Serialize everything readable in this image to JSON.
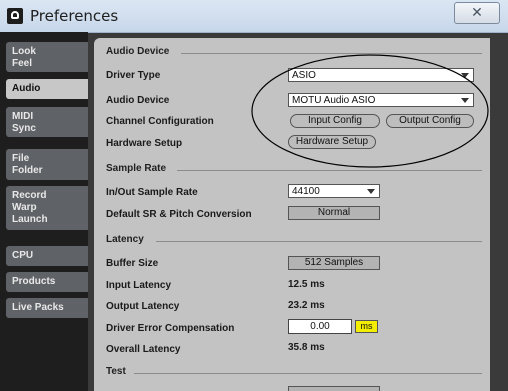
{
  "window": {
    "title": "Preferences",
    "close_glyph": "✕"
  },
  "sidebar": {
    "tabs": [
      {
        "lines": [
          "Look",
          "Feel"
        ]
      },
      {
        "lines": [
          "Audio"
        ]
      },
      {
        "lines": [
          "MIDI",
          "Sync"
        ]
      },
      {
        "lines": [
          "File",
          "Folder"
        ]
      },
      {
        "lines": [
          "Record",
          "Warp",
          "Launch"
        ]
      },
      {
        "lines": [
          "CPU"
        ]
      },
      {
        "lines": [
          "Products"
        ]
      },
      {
        "lines": [
          "Live Packs"
        ]
      }
    ],
    "active_tab": "Audio"
  },
  "audio_device": {
    "section_title": "Audio Device",
    "driver_type_label": "Driver Type",
    "driver_type_value": "ASIO",
    "audio_device_label": "Audio Device",
    "audio_device_value": "MOTU Audio ASIO",
    "channel_config_label": "Channel Configuration",
    "input_config_button": "Input Config",
    "output_config_button": "Output Config",
    "hardware_setup_label": "Hardware Setup",
    "hardware_setup_button": "Hardware Setup"
  },
  "sample_rate": {
    "section_title": "Sample Rate",
    "in_out_label": "In/Out Sample Rate",
    "in_out_value": "44100",
    "default_sr_label": "Default SR & Pitch Conversion",
    "default_sr_value": "Normal"
  },
  "latency": {
    "section_title": "Latency",
    "buffer_size_label": "Buffer Size",
    "buffer_size_value": "512 Samples",
    "input_latency_label": "Input Latency",
    "input_latency_value": "12.5 ms",
    "output_latency_label": "Output Latency",
    "output_latency_value": "23.2 ms",
    "driver_error_label": "Driver Error Compensation",
    "driver_error_value": "0.00",
    "driver_error_unit": "ms",
    "overall_latency_label": "Overall Latency",
    "overall_latency_value": "35.8 ms"
  },
  "test": {
    "section_title": "Test"
  },
  "colors": {
    "sidebar_bg": "#1e1e1e",
    "tab_bg": "#5f6266",
    "active_tab_bg": "#c7c7c7",
    "panel_bg": "#c3c3c3",
    "unit_highlight": "#f3ee00",
    "annotation": "#000000"
  },
  "icons": {
    "app": "ableton-live-icon",
    "dropdown": "chevron-down-icon"
  }
}
